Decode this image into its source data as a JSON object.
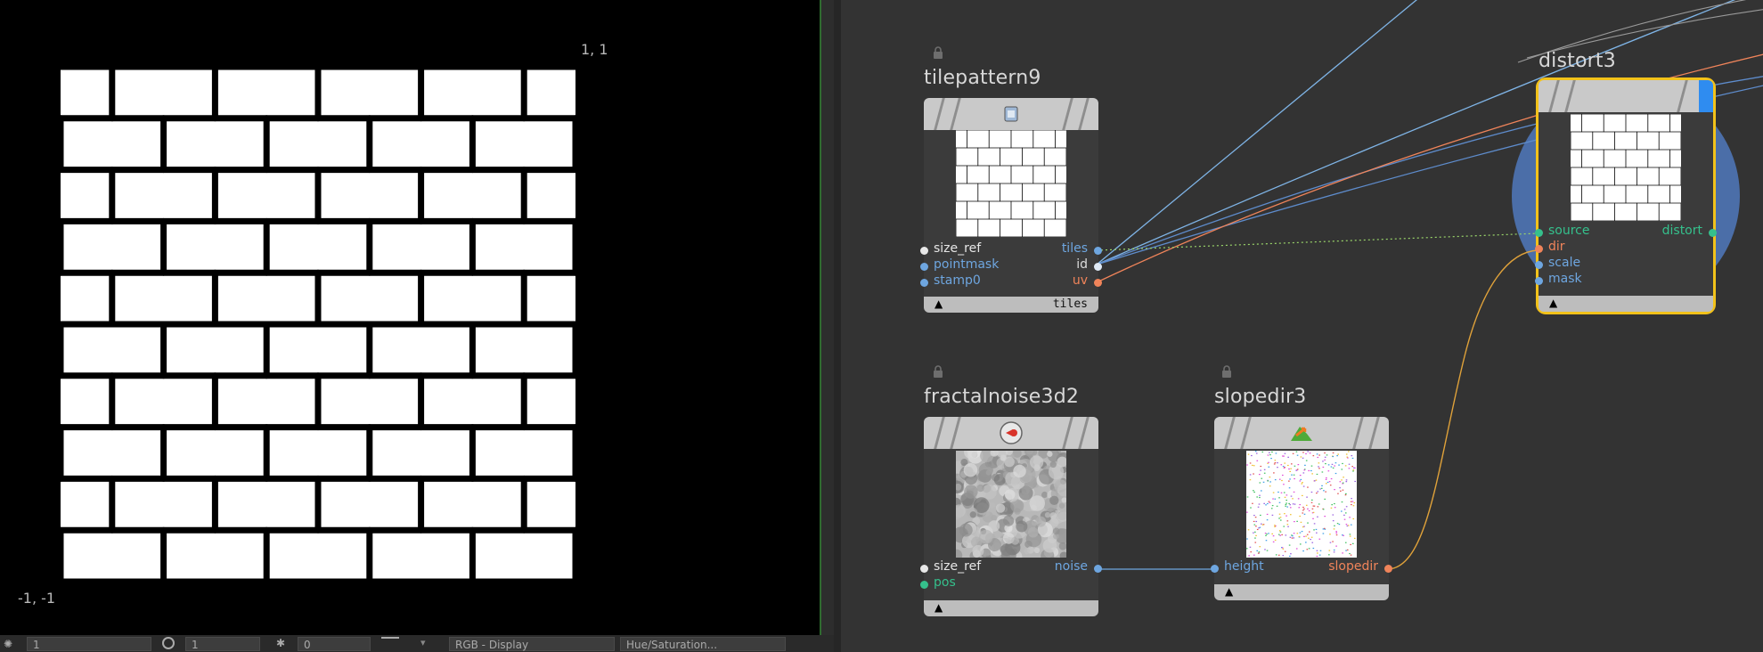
{
  "viewer": {
    "top_right_coord": "1, 1",
    "bottom_left_coord": "-1, -1"
  },
  "colors": {
    "port_blue": "#6ea6e0",
    "port_orange": "#f0845a",
    "port_green": "#35c08c",
    "port_white": "#e8e8e8",
    "selected_outline": "#f2c21a",
    "flag_blue": "#2f8cf0",
    "selection_halo": "#4b6ea8"
  },
  "nodes": {
    "tilepattern": {
      "title": "tilepattern9",
      "icon": "tile-icon",
      "footer_label": "tiles",
      "inputs": [
        "size_ref",
        "pointmask",
        "stamp0"
      ],
      "outputs": [
        "tiles",
        "id",
        "uv"
      ]
    },
    "distort": {
      "title": "distort3",
      "inputs": [
        "source",
        "dir",
        "scale",
        "mask"
      ],
      "outputs": [
        "distort"
      ]
    },
    "fractalnoise": {
      "title": "fractalnoise3d2",
      "icon": "noise-icon",
      "inputs": [
        "size_ref",
        "pos"
      ],
      "outputs": [
        "noise"
      ]
    },
    "slopedir": {
      "title": "slopedir3",
      "icon": "slope-icon",
      "inputs": [
        "height"
      ],
      "outputs": [
        "slopedir"
      ]
    }
  },
  "footer_arrow": "▲",
  "bottombar": {
    "field1": "1",
    "field2": "1",
    "field3": "0",
    "colorspace": "RGB - Display",
    "display": "Hue/Saturation..."
  }
}
